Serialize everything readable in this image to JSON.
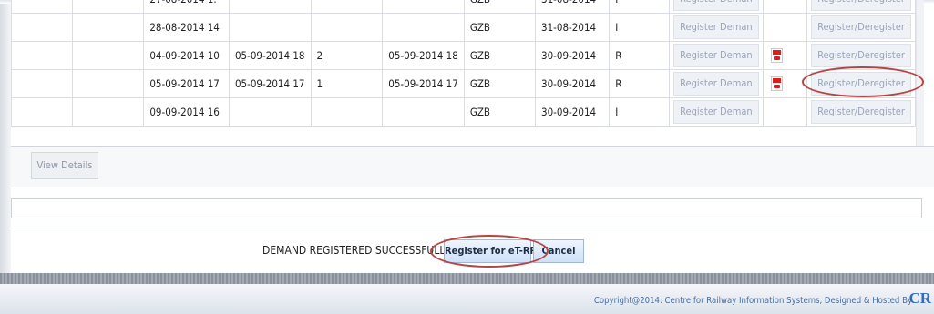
{
  "grid": {
    "rows": [
      {
        "col1": "",
        "col2": "",
        "date1": "27-08-2014 1:",
        "date2": "",
        "qty": "",
        "date3": "",
        "station": "GZB",
        "date4": "31-08-2014",
        "status": "I",
        "demand_btn": "Register Deman",
        "has_pdf": false,
        "reg_btn": "Register/Deregister"
      },
      {
        "col1": "",
        "col2": "",
        "date1": "28-08-2014 14",
        "date2": "",
        "qty": "",
        "date3": "",
        "station": "GZB",
        "date4": "31-08-2014",
        "status": "I",
        "demand_btn": "Register Deman",
        "has_pdf": false,
        "reg_btn": "Register/Deregister"
      },
      {
        "col1": "",
        "col2": "",
        "date1": "04-09-2014 10",
        "date2": "05-09-2014 18",
        "qty": "2",
        "date3": "05-09-2014 18",
        "station": "GZB",
        "date4": "30-09-2014",
        "status": "R",
        "demand_btn": "Register Deman",
        "has_pdf": true,
        "reg_btn": "Register/Deregister"
      },
      {
        "col1": "",
        "col2": "",
        "date1": "05-09-2014 17",
        "date2": "05-09-2014 17",
        "qty": "1",
        "date3": "05-09-2014 17",
        "station": "GZB",
        "date4": "30-09-2014",
        "status": "R",
        "demand_btn": "Register Deman",
        "has_pdf": true,
        "reg_btn": "Register/Deregister"
      },
      {
        "col1": "",
        "col2": "",
        "date1": "09-09-2014 16",
        "date2": "",
        "qty": "",
        "date3": "",
        "station": "GZB",
        "date4": "30-09-2014",
        "status": "I",
        "demand_btn": "Register Deman",
        "has_pdf": false,
        "reg_btn": "Register/Deregister"
      }
    ]
  },
  "panel": {
    "view_details": "View Details"
  },
  "status": {
    "message": "DEMAND REGISTERED SUCCESSFULLY.",
    "register_button": "Register for eT-RR",
    "cancel_button": "Cancel"
  },
  "footer": {
    "copyright": "Copyright@2014: Centre for Railway Information Systems, Designed & Hosted By",
    "logo_text": "CR"
  },
  "colors": {
    "annotation_ring": "#b54444",
    "primary_button": "#cfe0f7",
    "footer_text": "#4a6d9a"
  }
}
